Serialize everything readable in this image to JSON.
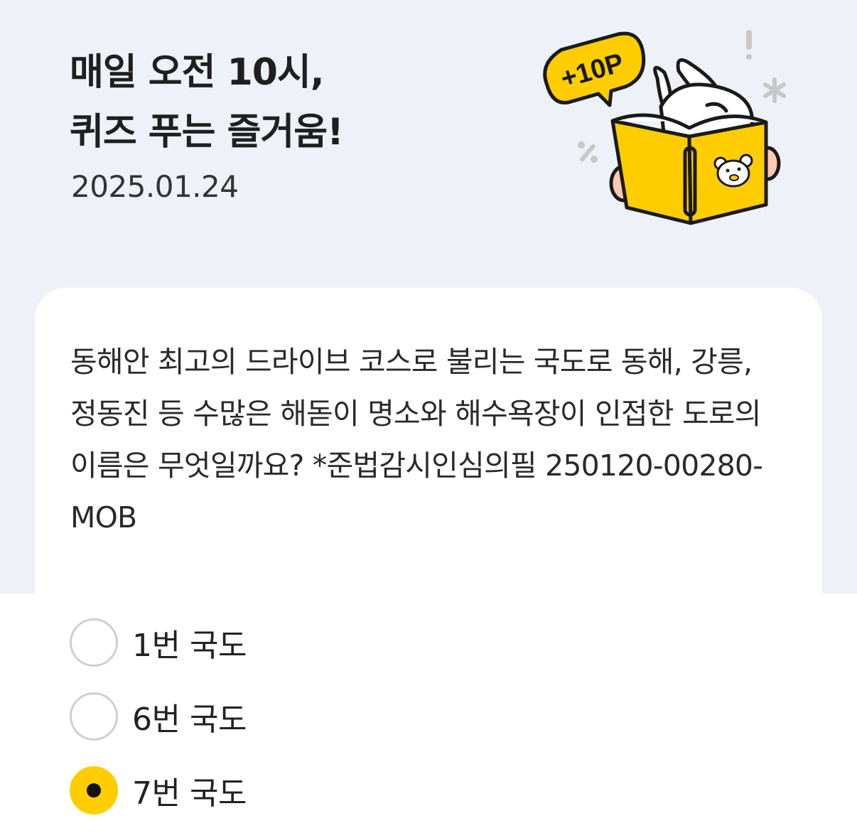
{
  "header": {
    "title_line1": "매일 오전 10시,",
    "title_line2": "퀴즈 푸는 즐거움!",
    "date": "2025.01.24",
    "badge_text": "+10P"
  },
  "quiz": {
    "question": "동해안 최고의 드라이브 코스로 불리는 국도로 동해, 강릉, 정동진 등 수많은 해돋이 명소와 해수욕장이 인접한 도로의 이름은 무엇일까요? *준법감시인심의필 250120-00280-MOB",
    "options": [
      {
        "label": "1번 국도",
        "selected": false
      },
      {
        "label": "6번 국도",
        "selected": false
      },
      {
        "label": "7번 국도",
        "selected": true
      }
    ]
  },
  "colors": {
    "header_bg": "#eef1f7",
    "accent": "#ffcd00",
    "radio_border": "#cfcfcf"
  },
  "icons": [
    "reading-rabbit-illustration",
    "points-badge-icon",
    "bear-logo-icon",
    "radio-icon"
  ]
}
